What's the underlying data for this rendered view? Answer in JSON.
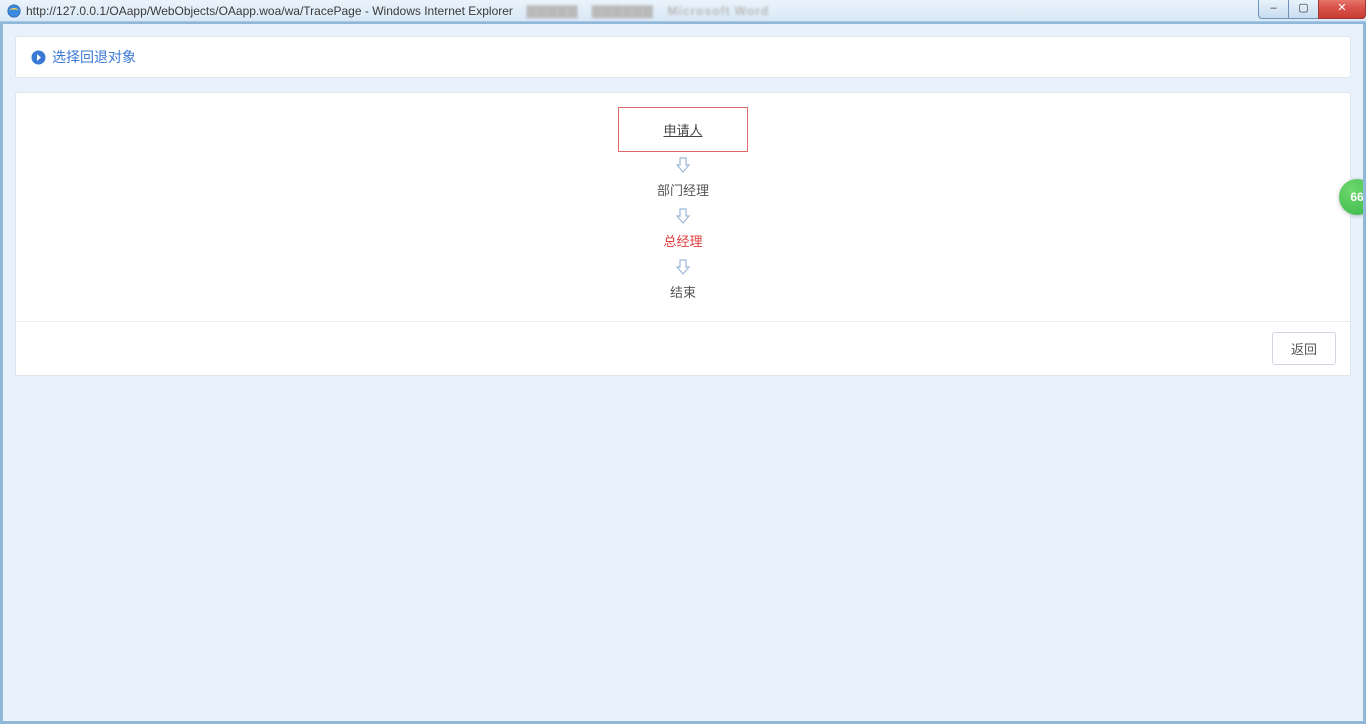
{
  "window": {
    "title": "http://127.0.0.1/OAapp/WebObjects/OAapp.woa/wa/TracePage - Windows Internet Explorer",
    "blurred_bg_apps": [
      "▇▇▇▇▇",
      "▇▇▇▇▇▇",
      "Microsoft Word"
    ],
    "buttons": {
      "min_glyph": "–",
      "max_glyph": "▢",
      "close_glyph": "✕"
    }
  },
  "header": {
    "title": "选择回退对象"
  },
  "flow": {
    "nodes": [
      {
        "label": "申请人",
        "boxed": true,
        "current": false
      },
      {
        "label": "部门经理",
        "boxed": false,
        "current": false
      },
      {
        "label": "总经理",
        "boxed": false,
        "current": true
      },
      {
        "label": "结束",
        "boxed": false,
        "current": false
      }
    ]
  },
  "footer": {
    "back_label": "返回"
  },
  "side_badge": {
    "text": "66"
  }
}
